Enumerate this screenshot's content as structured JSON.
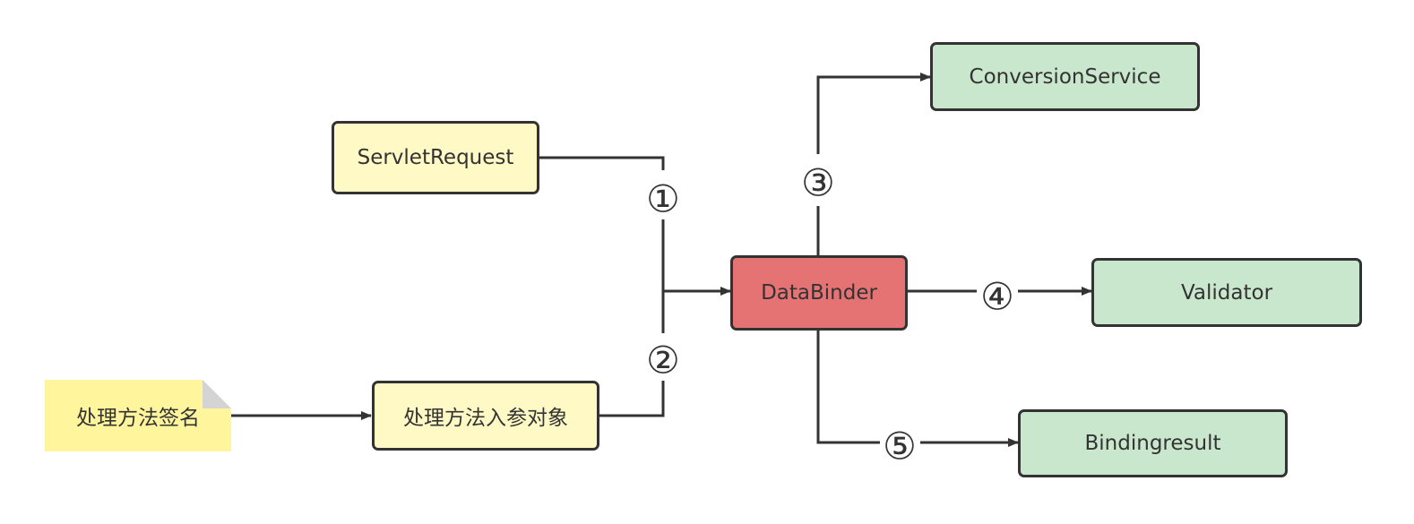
{
  "nodes": {
    "servlet_request": "ServletRequest",
    "method_signature": "处理方法签名",
    "method_args": "处理方法入参对象",
    "data_binder": "DataBinder",
    "conversion_service": "ConversionService",
    "validator": "Validator",
    "binding_result": "Bindingresult"
  },
  "steps": [
    "①",
    "②",
    "③",
    "④",
    "⑤"
  ],
  "colors": {
    "input_fill": "#fff9c5",
    "note_fill": "#fff59d",
    "binder_fill": "#e57373",
    "output_fill": "#c9e7cc",
    "stroke": "#333333"
  }
}
